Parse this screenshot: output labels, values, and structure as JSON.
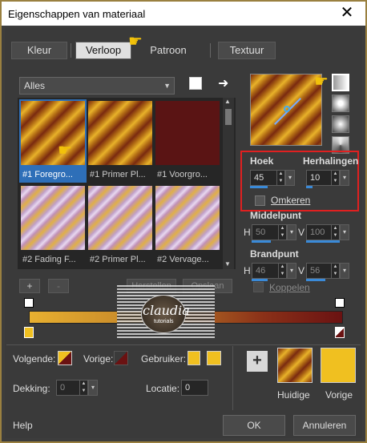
{
  "window": {
    "title": "Eigenschappen van materiaal"
  },
  "tabs": [
    {
      "label": "Kleur"
    },
    {
      "label": "Verloop"
    },
    {
      "label": "Patroon"
    },
    {
      "label": "Textuur"
    }
  ],
  "library": {
    "filter": "Alles",
    "thumbs": [
      {
        "label": "#1 Foregro..."
      },
      {
        "label": "#1 Primer Pl..."
      },
      {
        "label": "#1 Voorgro..."
      },
      {
        "label": "#2 Fading F..."
      },
      {
        "label": "#2 Primer Pl..."
      },
      {
        "label": "#2 Vervage..."
      }
    ],
    "add_label": "+",
    "remove_label": "-",
    "restore_label": "Herstellen",
    "save_label": "Opslaan"
  },
  "settings": {
    "angle_label": "Hoek",
    "angle_value": "45",
    "repeats_label": "Herhalingen",
    "repeats_value": "10",
    "invert_label": "Omkeren",
    "center_label": "Middelpunt",
    "center_h_label": "H",
    "center_h": "50",
    "center_v_label": "V",
    "center_v": "100",
    "focal_label": "Brandpunt",
    "focal_h_label": "H",
    "focal_h": "46",
    "focal_v_label": "V",
    "focal_v": "56",
    "link_label": "Koppelen"
  },
  "bottom": {
    "next_label": "Volgende:",
    "prev_label": "Vorige:",
    "user_label": "Gebruiker:",
    "opacity_label": "Dekking:",
    "opacity_value": "0",
    "location_label": "Locatie:",
    "location_value": "0",
    "current_label": "Huidige",
    "previous_label": "Vorige",
    "plus_label": "+"
  },
  "footer": {
    "help": "Help",
    "ok": "OK",
    "cancel": "Annuleren"
  },
  "watermark": {
    "text": "claudia",
    "sub": "tutorials"
  },
  "colors": {
    "accent": "#3a8ad8",
    "gold": "#f0c020",
    "dark_red": "#6a1212",
    "highlight": "#e02020"
  }
}
